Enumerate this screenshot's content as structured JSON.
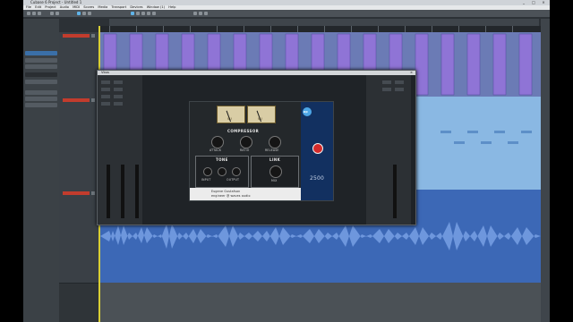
{
  "app": {
    "window_title": "Cubase 6 Project - Untitled 1",
    "menu": [
      "File",
      "Edit",
      "Project",
      "Audio",
      "MIDI",
      "Scores",
      "Media",
      "Transport",
      "Devices",
      "Window (1)",
      "Help"
    ],
    "window_controls": [
      "_",
      "□",
      "×"
    ]
  },
  "plugin": {
    "window_title": "Vbus",
    "close_label": "×",
    "device": {
      "compressor_label": "COMPRESSOR",
      "tone_label": "TONE",
      "link_label": "LINK",
      "meter_left": "VU",
      "meter_right": "VU",
      "knob_labels": [
        "ATTACK",
        "RATIO",
        "RELEASE",
        "INPUT",
        "OUTPUT",
        "MIX"
      ],
      "footer_line1": "Eugene Gustafson",
      "footer_line2": "engineer @ waves audio",
      "brand_side": "2500",
      "brand_logo": "ap"
    }
  },
  "colors": {
    "midi_lane": "#6b7bb5",
    "audio_lane_light": "#8ab8e3",
    "audio_lane_dark": "#3c68b6",
    "cursor": "#d9cf35",
    "track_name": "#c23c2d"
  }
}
